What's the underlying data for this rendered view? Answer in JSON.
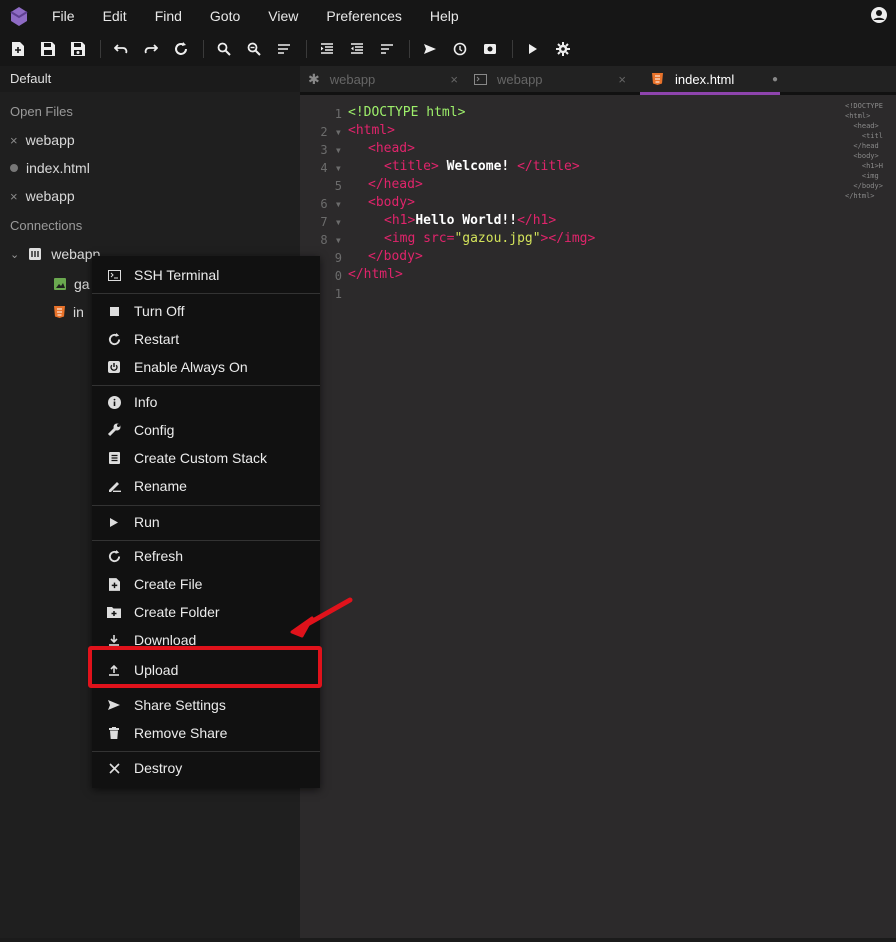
{
  "menubar": {
    "items": [
      "File",
      "Edit",
      "Find",
      "Goto",
      "View",
      "Preferences",
      "Help"
    ]
  },
  "toolbar": {
    "icons": [
      "new-file-icon",
      "save-icon",
      "save-all-icon",
      "undo-icon",
      "redo-icon",
      "reload-icon",
      "search-icon",
      "replace-icon",
      "wrap-icon",
      "indent-icon",
      "outdent-icon",
      "align-icon",
      "send-icon",
      "history-icon",
      "preview-icon",
      "play-icon",
      "settings-icon"
    ]
  },
  "sidebar": {
    "header": "Default",
    "open_files_label": "Open Files",
    "open_files": [
      {
        "label": "webapp",
        "marker": "×"
      },
      {
        "label": "index.html",
        "marker": "dot"
      },
      {
        "label": "webapp",
        "marker": "×"
      }
    ],
    "connections_label": "Connections",
    "connection": {
      "label": "webapp"
    },
    "tree": [
      {
        "label": "ga",
        "icon": "image-icon",
        "color": "#6aa84f"
      },
      {
        "label": "in",
        "icon": "html5-icon",
        "color": "#e8722a"
      }
    ]
  },
  "tabs": [
    {
      "label": "webapp",
      "icon": "asterisk",
      "close": "×",
      "active": false
    },
    {
      "label": "webapp",
      "icon": "terminal-icon",
      "close": "×",
      "active": false
    },
    {
      "label": "index.html",
      "icon": "html5-icon",
      "close": "●",
      "active": true
    }
  ],
  "editor": {
    "line_numbers": [
      "1",
      "2",
      "3",
      "4",
      "5",
      "6",
      "7",
      "8",
      "9",
      "0",
      "1"
    ],
    "code": {
      "l1": "<!DOCTYPE html>",
      "l2": "<html>",
      "l3": "<head>",
      "l4_open": "<title>",
      "l4_text": " Welcome! ",
      "l4_close": "</title>",
      "l5": "</head>",
      "l6": "<body>",
      "l7_open": "<h1>",
      "l7_text": "Hello World!!",
      "l7_close": "</h1>",
      "l8_open": "<img src=",
      "l8_attr": "\"gazou.jpg\"",
      "l8_close": "></img>",
      "l9": "</body>",
      "l10": "</html>"
    },
    "minimap": "<!DOCTYPE\n<html>\n  <head>\n    <titl\n  </head\n  <body>\n    <h1>H\n    <img\n  </body>\n</html>"
  },
  "context_menu": {
    "items": [
      {
        "label": "SSH Terminal",
        "icon": "terminal-icon"
      },
      {
        "label": "Turn Off",
        "icon": "stop-icon"
      },
      {
        "label": "Restart",
        "icon": "restart-icon"
      },
      {
        "label": "Enable Always On",
        "icon": "power-icon"
      },
      {
        "label": "Info",
        "icon": "info-icon"
      },
      {
        "label": "Config",
        "icon": "wrench-icon"
      },
      {
        "label": "Create Custom Stack",
        "icon": "stack-icon"
      },
      {
        "label": "Rename",
        "icon": "pencil-icon"
      },
      {
        "label": "Run",
        "icon": "play-icon"
      },
      {
        "label": "Refresh",
        "icon": "refresh-icon"
      },
      {
        "label": "Create File",
        "icon": "new-file-icon"
      },
      {
        "label": "Create Folder",
        "icon": "new-folder-icon"
      },
      {
        "label": "Download",
        "icon": "download-icon"
      },
      {
        "label": "Upload",
        "icon": "upload-icon"
      },
      {
        "label": "Share Settings",
        "icon": "share-icon"
      },
      {
        "label": "Remove Share",
        "icon": "trash-icon"
      },
      {
        "label": "Destroy",
        "icon": "close-icon"
      }
    ]
  },
  "colors": {
    "accent": "#8e44ad",
    "highlight": "#e0121b",
    "tag": "#e0246b",
    "string": "#d3e35a"
  }
}
